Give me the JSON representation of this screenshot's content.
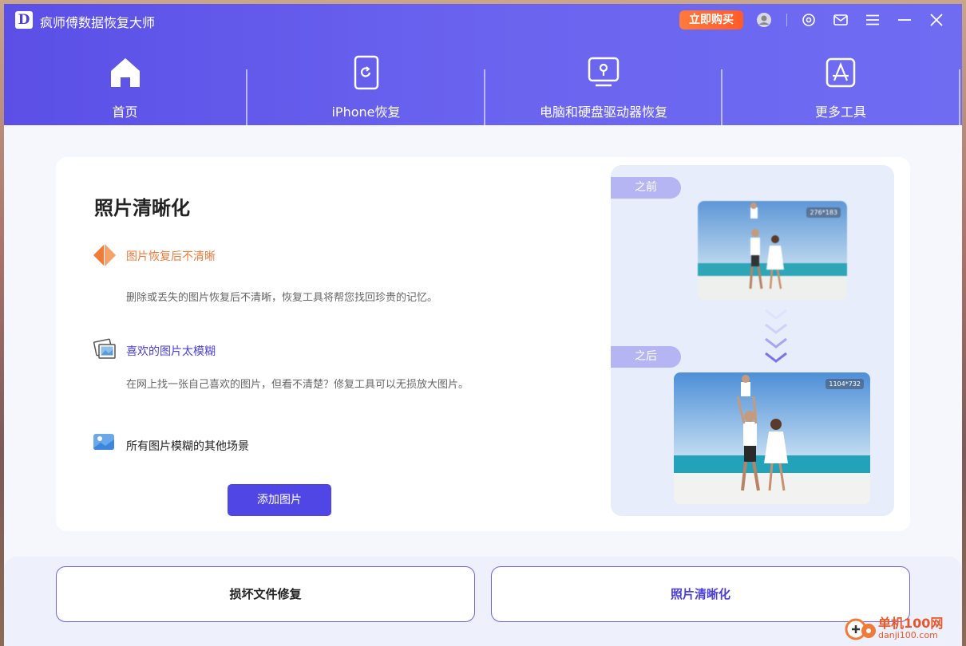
{
  "app": {
    "logo_letter": "D",
    "title": "疯师傅数据恢复大师",
    "buy_label": "立即购买"
  },
  "titlebar_icons": [
    "user-icon",
    "settings-icon",
    "mail-icon",
    "menu-icon",
    "minimize-icon",
    "close-icon"
  ],
  "nav": {
    "items": [
      {
        "label": "首页",
        "icon": "home-icon"
      },
      {
        "label": "iPhone恢复",
        "icon": "phone-recover-icon"
      },
      {
        "label": "电脑和硬盘驱动器恢复",
        "icon": "computer-recover-icon"
      },
      {
        "label": "更多工具",
        "icon": "app-store-icon"
      }
    ]
  },
  "main": {
    "title": "照片清晰化",
    "features": [
      {
        "title": "图片恢复后不清晰",
        "desc": "删除或丢失的图片恢复后不清晰，恢复工具将帮您找回珍贵的记忆。",
        "icon": "diamond-icon"
      },
      {
        "title": "喜欢的图片太模糊",
        "desc": "在网上找一张自己喜欢的图片，但看不清楚？修复工具可以无损放大图片。",
        "icon": "photos-icon"
      },
      {
        "title": "所有图片模糊的其他场景",
        "desc": "",
        "icon": "image-icon"
      }
    ],
    "add_button": "添加图片",
    "preview": {
      "before_label": "之前",
      "after_label": "之后",
      "before_res": "276*183",
      "after_res": "1104*732"
    }
  },
  "bottom": {
    "tools": [
      {
        "label": "损坏文件修复"
      },
      {
        "label": "照片清晰化"
      }
    ]
  },
  "watermark": {
    "text": "单机100网",
    "url": "danji100.com"
  },
  "colors": {
    "brand": "#5046e5",
    "accent_orange": "#f07a3a",
    "header_start": "#5b4fe6",
    "header_end": "#6f6cf2"
  }
}
